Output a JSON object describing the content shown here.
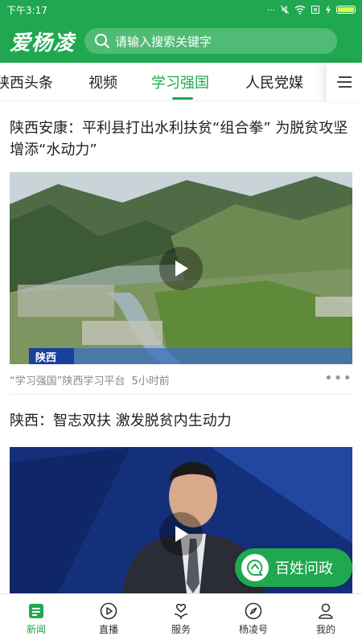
{
  "status_bar": {
    "time": "下午3:17",
    "dots": "···"
  },
  "header": {
    "logo": "爱杨凌",
    "search_placeholder": "请输入搜索关键字"
  },
  "tabs": [
    {
      "label": "陕西头条",
      "active": false
    },
    {
      "label": "视频",
      "active": false
    },
    {
      "label": "学习强国",
      "active": true
    },
    {
      "label": "人民党媒",
      "active": false
    }
  ],
  "articles": [
    {
      "title": "陕西安康：平利县打出水利扶贫“组合拳” 为脱贫攻坚增添“水动力”",
      "video_caption": "陕西",
      "source": "“学习强国”陕西学习平台",
      "time": "5小时前"
    },
    {
      "title": "陕西：智志双扶 激发脱贫内生动力"
    }
  ],
  "fab": {
    "label": "百姓问政"
  },
  "bottom_nav": [
    {
      "label": "新闻",
      "icon": "news-icon",
      "active": true
    },
    {
      "label": "直播",
      "icon": "live-play-icon",
      "active": false
    },
    {
      "label": "服务",
      "icon": "service-heart-icon",
      "active": false
    },
    {
      "label": "杨凌号",
      "icon": "compass-icon",
      "active": false
    },
    {
      "label": "我的",
      "icon": "profile-icon",
      "active": false
    }
  ],
  "colors": {
    "brand_green": "#1fa84f",
    "text": "#222222",
    "meta": "#888888"
  }
}
